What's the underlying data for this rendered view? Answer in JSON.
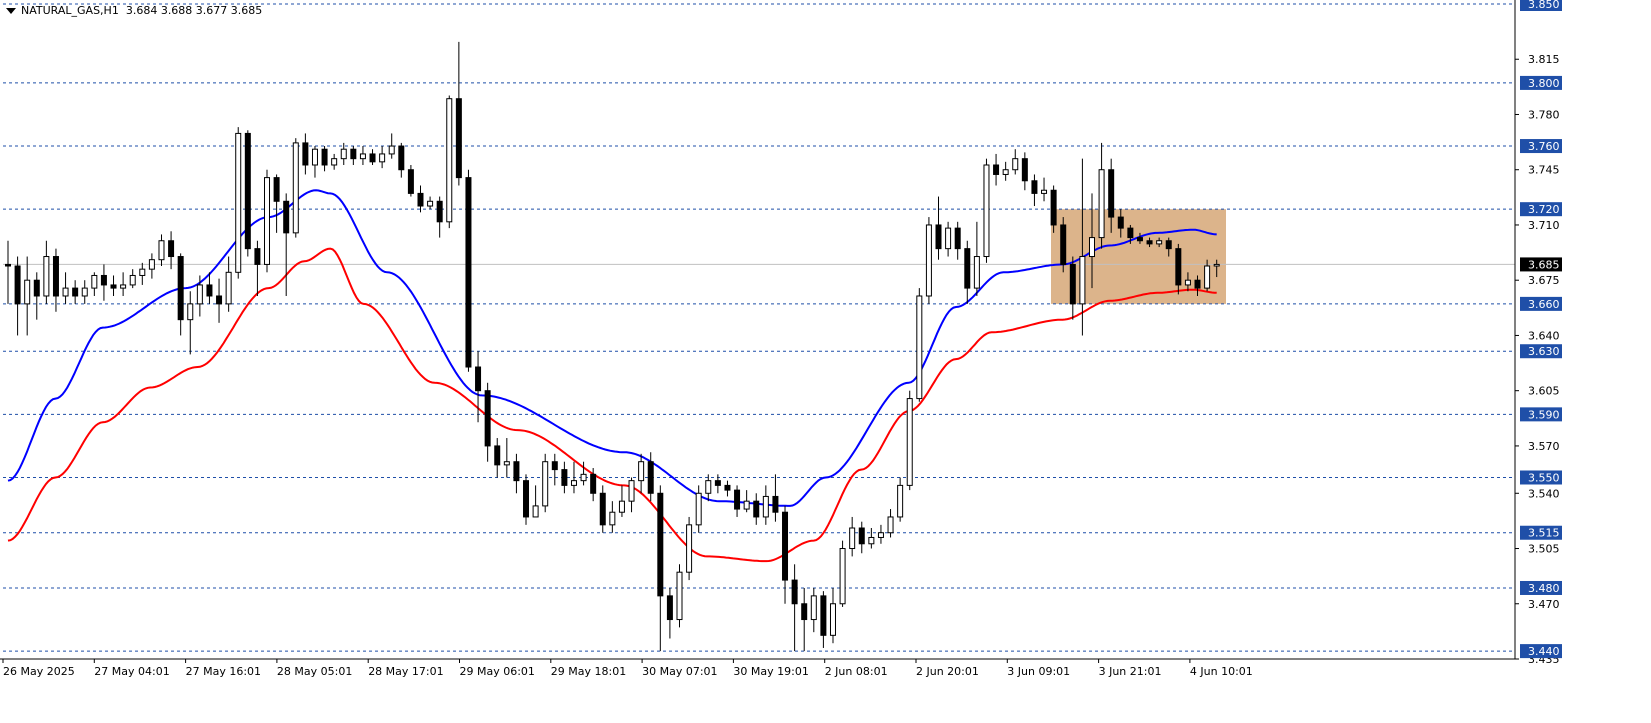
{
  "header": {
    "symbol": "NATURAL_GAS,H1",
    "ohlc": "3.684 3.688 3.677 3.685"
  },
  "colors": {
    "bull_candle": "#ffffff",
    "bear_candle": "#000000",
    "ma_fast": "#0000ff",
    "ma_slow": "#ff0000",
    "grid_dash": "#1f4fa8",
    "level_label_bg": "#1f4fa8",
    "current_price_line": "#c0c0c0",
    "consolidation_box": "#d6a777"
  },
  "chart_data": {
    "type": "candlestick",
    "ylim": [
      3.435,
      3.85
    ],
    "price_ticks": [
      "3.815",
      "3.780",
      "3.745",
      "3.710",
      "3.675",
      "3.640",
      "3.605",
      "3.570",
      "3.540",
      "3.505",
      "3.470",
      "3.435"
    ],
    "levels": [
      "3.850",
      "3.800",
      "3.760",
      "3.720",
      "3.660",
      "3.630",
      "3.590",
      "3.550",
      "3.515",
      "3.480",
      "3.440"
    ],
    "current_price": "3.685",
    "x_labels": [
      "26 May 2025",
      "27 May 04:01",
      "27 May 16:01",
      "28 May 05:01",
      "28 May 17:01",
      "29 May 06:01",
      "29 May 18:01",
      "30 May 07:01",
      "30 May 19:01",
      "2 Jun 08:01",
      "2 Jun 20:01",
      "3 Jun 09:01",
      "3 Jun 21:01",
      "4 Jun 10:01"
    ],
    "consolidation_zone": {
      "start_bar": 207,
      "end_bar": 241,
      "high": 3.72,
      "low": 3.66
    },
    "ma_fast_nodes": [
      [
        0,
        3.548
      ],
      [
        20,
        3.6
      ],
      [
        40,
        3.645
      ],
      [
        75,
        3.67
      ],
      [
        110,
        3.715
      ],
      [
        130,
        3.732
      ],
      [
        136,
        3.73
      ],
      [
        160,
        3.68
      ],
      [
        200,
        3.602
      ],
      [
        260,
        3.566
      ],
      [
        300,
        3.535
      ],
      [
        330,
        3.532
      ],
      [
        345,
        3.55
      ],
      [
        380,
        3.61
      ],
      [
        400,
        3.658
      ],
      [
        420,
        3.68
      ],
      [
        445,
        3.685
      ],
      [
        465,
        3.697
      ],
      [
        485,
        3.705
      ],
      [
        500,
        3.707
      ],
      [
        510,
        3.704
      ]
    ],
    "ma_slow_nodes": [
      [
        0,
        3.51
      ],
      [
        20,
        3.55
      ],
      [
        40,
        3.585
      ],
      [
        60,
        3.607
      ],
      [
        80,
        3.62
      ],
      [
        110,
        3.67
      ],
      [
        125,
        3.687
      ],
      [
        136,
        3.695
      ],
      [
        150,
        3.66
      ],
      [
        180,
        3.61
      ],
      [
        215,
        3.58
      ],
      [
        260,
        3.545
      ],
      [
        295,
        3.5
      ],
      [
        320,
        3.497
      ],
      [
        340,
        3.51
      ],
      [
        360,
        3.555
      ],
      [
        380,
        3.592
      ],
      [
        400,
        3.625
      ],
      [
        415,
        3.642
      ],
      [
        445,
        3.65
      ],
      [
        465,
        3.662
      ],
      [
        485,
        3.667
      ],
      [
        500,
        3.669
      ],
      [
        510,
        3.667
      ]
    ],
    "candles": [
      [
        3.685,
        3.684,
        3.7,
        3.66
      ],
      [
        3.684,
        3.66,
        3.69,
        3.64
      ],
      [
        3.66,
        3.675,
        3.69,
        3.64
      ],
      [
        3.675,
        3.665,
        3.68,
        3.65
      ],
      [
        3.665,
        3.69,
        3.7,
        3.66
      ],
      [
        3.69,
        3.665,
        3.695,
        3.655
      ],
      [
        3.665,
        3.67,
        3.68,
        3.66
      ],
      [
        3.67,
        3.665,
        3.675,
        3.66
      ],
      [
        3.665,
        3.67,
        3.675,
        3.66
      ],
      [
        3.67,
        3.678,
        3.68,
        3.665
      ],
      [
        3.678,
        3.672,
        3.685,
        3.662
      ],
      [
        3.672,
        3.67,
        3.678,
        3.665
      ],
      [
        3.67,
        3.672,
        3.68,
        3.665
      ],
      [
        3.672,
        3.678,
        3.682,
        3.67
      ],
      [
        3.678,
        3.682,
        3.686,
        3.672
      ],
      [
        3.682,
        3.688,
        3.692,
        3.676
      ],
      [
        3.688,
        3.7,
        3.704,
        3.684
      ],
      [
        3.7,
        3.69,
        3.706,
        3.682
      ],
      [
        3.69,
        3.65,
        3.692,
        3.64
      ],
      [
        3.65,
        3.66,
        3.668,
        3.628
      ],
      [
        3.66,
        3.672,
        3.678,
        3.652
      ],
      [
        3.672,
        3.665,
        3.68,
        3.66
      ],
      [
        3.665,
        3.66,
        3.676,
        3.648
      ],
      [
        3.66,
        3.68,
        3.69,
        3.655
      ],
      [
        3.68,
        3.768,
        3.772,
        3.676
      ],
      [
        3.768,
        3.695,
        3.77,
        3.69
      ],
      [
        3.695,
        3.685,
        3.7,
        3.665
      ],
      [
        3.685,
        3.74,
        3.745,
        3.68
      ],
      [
        3.74,
        3.725,
        3.742,
        3.705
      ],
      [
        3.725,
        3.705,
        3.73,
        3.665
      ],
      [
        3.705,
        3.762,
        3.765,
        3.702
      ],
      [
        3.762,
        3.748,
        3.768,
        3.742
      ],
      [
        3.748,
        3.758,
        3.76,
        3.74
      ],
      [
        3.758,
        3.748,
        3.76,
        3.744
      ],
      [
        3.748,
        3.752,
        3.755,
        3.745
      ],
      [
        3.752,
        3.758,
        3.762,
        3.748
      ],
      [
        3.758,
        3.752,
        3.76,
        3.748
      ],
      [
        3.752,
        3.755,
        3.76,
        3.748
      ],
      [
        3.755,
        3.75,
        3.758,
        3.748
      ],
      [
        3.75,
        3.755,
        3.76,
        3.746
      ],
      [
        3.755,
        3.76,
        3.768,
        3.752
      ],
      [
        3.76,
        3.745,
        3.762,
        3.74
      ],
      [
        3.745,
        3.73,
        3.748,
        3.728
      ],
      [
        3.73,
        3.722,
        3.735,
        3.718
      ],
      [
        3.722,
        3.725,
        3.728,
        3.72
      ],
      [
        3.725,
        3.712,
        3.728,
        3.702
      ],
      [
        3.712,
        3.79,
        3.792,
        3.708
      ],
      [
        3.79,
        3.74,
        3.826,
        3.735
      ],
      [
        3.74,
        3.62,
        3.745,
        3.617
      ],
      [
        3.62,
        3.605,
        3.63,
        3.585
      ],
      [
        3.605,
        3.57,
        3.61,
        3.56
      ],
      [
        3.57,
        3.558,
        3.575,
        3.55
      ],
      [
        3.558,
        3.56,
        3.575,
        3.55
      ],
      [
        3.56,
        3.548,
        3.565,
        3.54
      ],
      [
        3.548,
        3.525,
        3.552,
        3.52
      ],
      [
        3.525,
        3.532,
        3.545,
        3.525
      ],
      [
        3.532,
        3.56,
        3.565,
        3.528
      ],
      [
        3.56,
        3.555,
        3.565,
        3.545
      ],
      [
        3.555,
        3.545,
        3.56,
        3.54
      ],
      [
        3.545,
        3.548,
        3.56,
        3.54
      ],
      [
        3.548,
        3.552,
        3.56,
        3.545
      ],
      [
        3.552,
        3.54,
        3.556,
        3.535
      ],
      [
        3.54,
        3.52,
        3.545,
        3.515
      ],
      [
        3.52,
        3.528,
        3.535,
        3.515
      ],
      [
        3.528,
        3.535,
        3.545,
        3.525
      ],
      [
        3.535,
        3.548,
        3.55,
        3.528
      ],
      [
        3.548,
        3.56,
        3.565,
        3.54
      ],
      [
        3.56,
        3.54,
        3.566,
        3.535
      ],
      [
        3.54,
        3.475,
        3.545,
        3.44
      ],
      [
        3.475,
        3.46,
        3.48,
        3.448
      ],
      [
        3.46,
        3.49,
        3.495,
        3.455
      ],
      [
        3.49,
        3.52,
        3.525,
        3.485
      ],
      [
        3.52,
        3.54,
        3.545,
        3.515
      ],
      [
        3.54,
        3.548,
        3.552,
        3.535
      ],
      [
        3.548,
        3.545,
        3.552,
        3.54
      ],
      [
        3.545,
        3.542,
        3.548,
        3.538
      ],
      [
        3.542,
        3.53,
        3.545,
        3.525
      ],
      [
        3.53,
        3.535,
        3.542,
        3.528
      ],
      [
        3.535,
        3.525,
        3.54,
        3.52
      ],
      [
        3.525,
        3.538,
        3.545,
        3.52
      ],
      [
        3.538,
        3.528,
        3.552,
        3.522
      ],
      [
        3.528,
        3.485,
        3.532,
        3.47
      ],
      [
        3.485,
        3.47,
        3.495,
        3.44
      ],
      [
        3.47,
        3.46,
        3.48,
        3.44
      ],
      [
        3.46,
        3.475,
        3.48,
        3.452
      ],
      [
        3.475,
        3.45,
        3.478,
        3.442
      ],
      [
        3.45,
        3.47,
        3.48,
        3.445
      ],
      [
        3.47,
        3.505,
        3.51,
        3.468
      ],
      [
        3.505,
        3.518,
        3.525,
        3.5
      ],
      [
        3.518,
        3.508,
        3.522,
        3.502
      ],
      [
        3.508,
        3.512,
        3.518,
        3.505
      ],
      [
        3.512,
        3.515,
        3.52,
        3.508
      ],
      [
        3.515,
        3.525,
        3.53,
        3.512
      ],
      [
        3.525,
        3.545,
        3.55,
        3.522
      ],
      [
        3.545,
        3.6,
        3.605,
        3.542
      ],
      [
        3.6,
        3.665,
        3.67,
        3.598
      ],
      [
        3.665,
        3.71,
        3.715,
        3.66
      ],
      [
        3.71,
        3.695,
        3.728,
        3.688
      ],
      [
        3.695,
        3.708,
        3.712,
        3.69
      ],
      [
        3.708,
        3.695,
        3.712,
        3.688
      ],
      [
        3.695,
        3.67,
        3.7,
        3.66
      ],
      [
        3.67,
        3.69,
        3.712,
        3.665
      ],
      [
        3.69,
        3.748,
        3.752,
        3.686
      ],
      [
        3.748,
        3.742,
        3.755,
        3.735
      ],
      [
        3.742,
        3.745,
        3.75,
        3.738
      ],
      [
        3.745,
        3.752,
        3.758,
        3.742
      ],
      [
        3.752,
        3.738,
        3.756,
        3.732
      ],
      [
        3.738,
        3.73,
        3.742,
        3.722
      ],
      [
        3.73,
        3.732,
        3.74,
        3.725
      ],
      [
        3.732,
        3.71,
        3.735,
        3.705
      ],
      [
        3.71,
        3.685,
        3.715,
        3.68
      ],
      [
        3.685,
        3.66,
        3.69,
        3.65
      ],
      [
        3.66,
        3.69,
        3.752,
        3.64
      ],
      [
        3.69,
        3.702,
        3.73,
        3.67
      ],
      [
        3.702,
        3.745,
        3.762,
        3.695
      ],
      [
        3.745,
        3.715,
        3.752,
        3.705
      ],
      [
        3.715,
        3.708,
        3.72,
        3.702
      ],
      [
        3.708,
        3.702,
        3.71,
        3.698
      ],
      [
        3.702,
        3.7,
        3.705,
        3.698
      ],
      [
        3.7,
        3.698,
        3.702,
        3.696
      ],
      [
        3.698,
        3.7,
        3.702,
        3.696
      ],
      [
        3.7,
        3.695,
        3.702,
        3.69
      ],
      [
        3.695,
        3.672,
        3.698,
        3.666
      ],
      [
        3.672,
        3.675,
        3.68,
        3.668
      ],
      [
        3.675,
        3.67,
        3.678,
        3.665
      ],
      [
        3.67,
        3.684,
        3.688,
        3.668
      ],
      [
        3.684,
        3.685,
        3.688,
        3.677
      ]
    ]
  }
}
